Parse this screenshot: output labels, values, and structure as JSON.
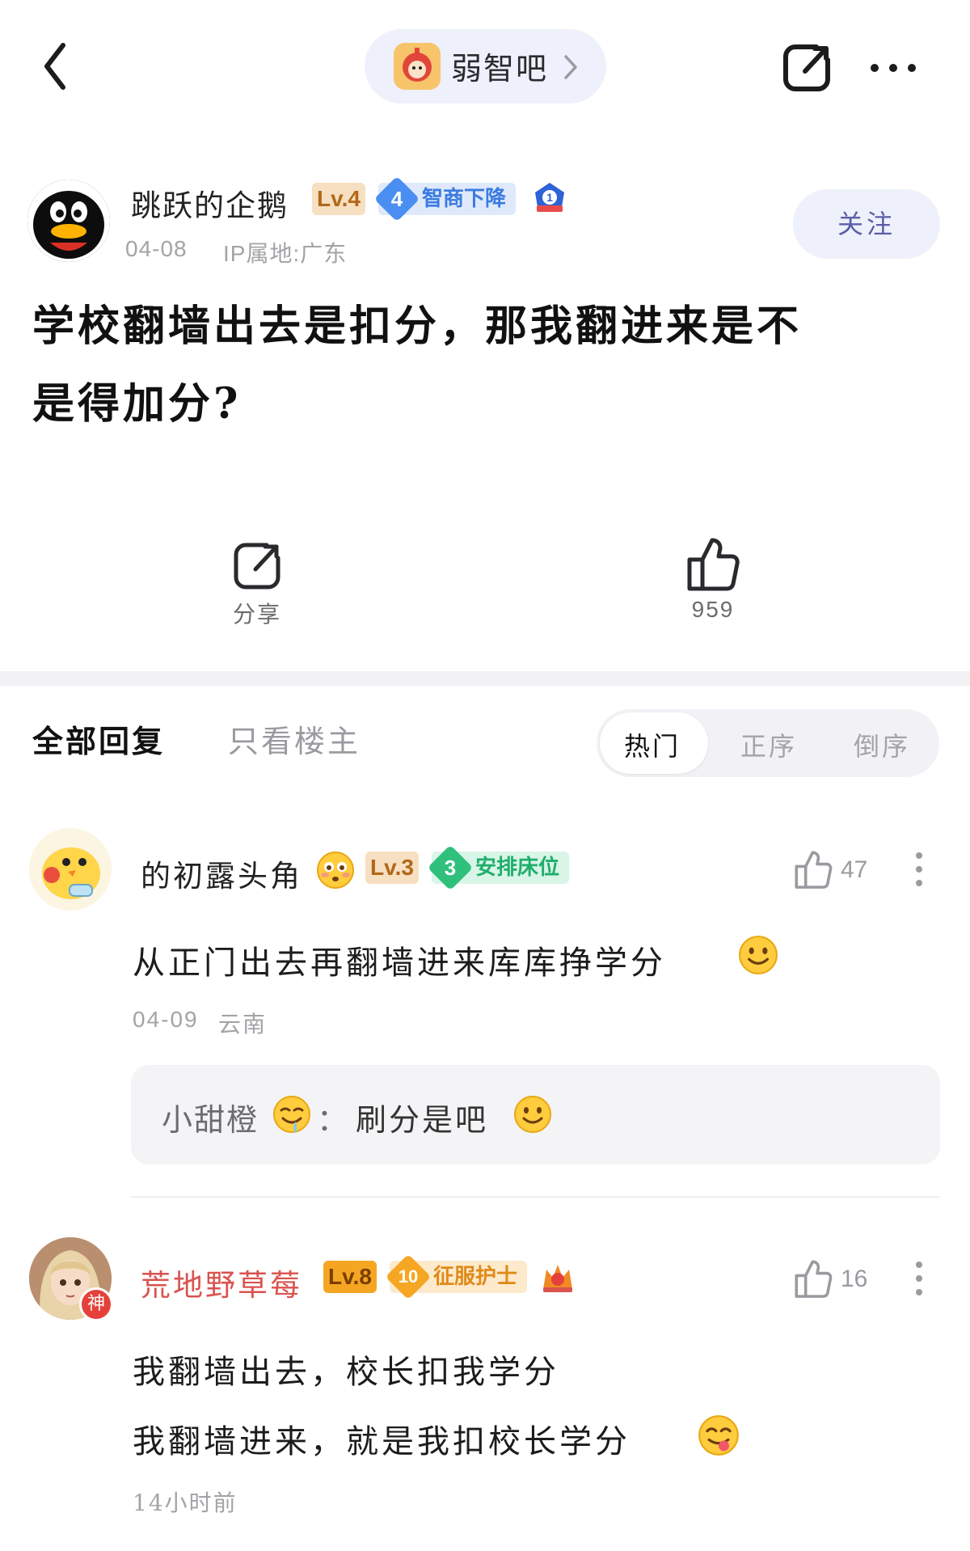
{
  "header": {
    "forum_name": "弱智吧"
  },
  "post": {
    "author": {
      "name": "跳跃的企鹅",
      "level": "Lv.4",
      "title_num": "4",
      "title": "智商下降",
      "rank_num": "1"
    },
    "date": "04-08",
    "ip": "IP属地:广东",
    "follow_label": "关注",
    "title_line1": "学校翻墙出去是扣分，那我翻进来是不",
    "title_line2": "是得加分?",
    "actions": {
      "share_label": "分享",
      "like_count": "959"
    }
  },
  "tabs": {
    "all_replies": "全部回复",
    "op_only": "只看楼主",
    "sort": [
      "热门",
      "正序",
      "倒序"
    ]
  },
  "comments": [
    {
      "name": "的初露头角",
      "level": "Lv.3",
      "title_num": "3",
      "title": "安排床位",
      "likes": "47",
      "text": "从正门出去再翻墙进来库库挣学分",
      "date": "04-09",
      "location": "云南",
      "reply": {
        "user": "小甜橙",
        "separator": "：",
        "text": "刷分是吧"
      }
    },
    {
      "name": "荒地野草莓",
      "badge": "神",
      "level": "Lv.8",
      "title_num": "10",
      "title": "征服护士",
      "likes": "16",
      "text_line1": "我翻墙出去，校长扣我学分",
      "text_line2": "我翻墙进来，就是我扣校长学分",
      "time": "14小时前"
    }
  ],
  "colors": {
    "accent_pill": "#eef0fb",
    "level_badge": "#f7dfc2",
    "commenter2_name": "#d9534f",
    "follow_text": "#5b5ea6"
  }
}
